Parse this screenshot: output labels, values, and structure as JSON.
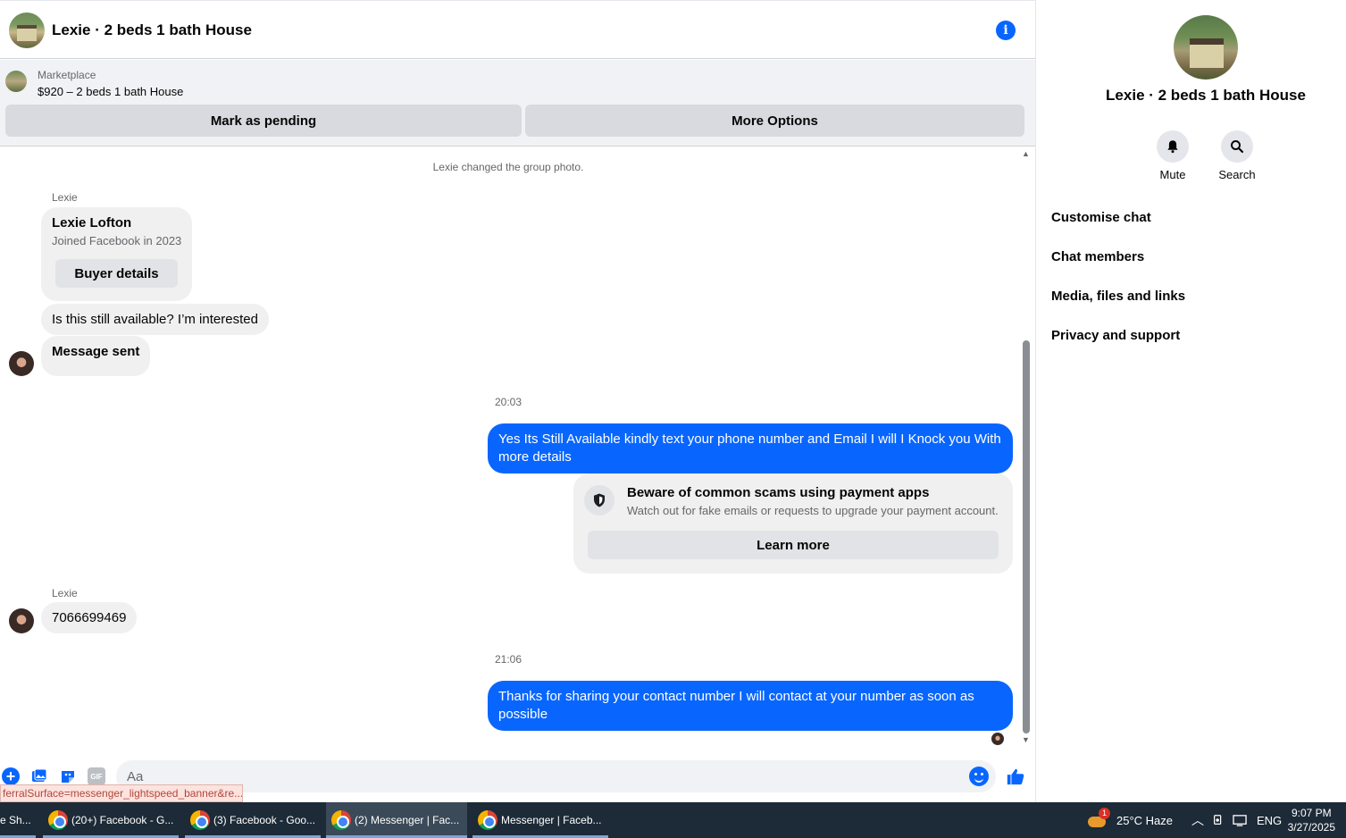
{
  "header": {
    "title": "Lexie · 2 beds 1 bath House"
  },
  "marketplace": {
    "label": "Marketplace",
    "listing": "$920 – 2 beds 1 bath House",
    "pending_btn": "Mark as pending",
    "more_btn": "More Options"
  },
  "messages": {
    "system_top": "Lexie changed the group photo.",
    "sender_1": "Lexie",
    "profile": {
      "name": "Lexie Lofton",
      "joined": "Joined Facebook in 2023",
      "button": "Buyer details"
    },
    "msg_1": "Is this still available? I’m interested",
    "msg_2": "Message sent",
    "time_1": "20:03",
    "out_1": "Yes Its Still Available kindly text your phone number and Email I will I Knock you With more details",
    "scam": {
      "title": "Beware of common scams using payment apps",
      "desc": "Watch out for fake emails or requests to upgrade your payment account.",
      "button": "Learn more"
    },
    "sender_2": "Lexie",
    "msg_3": "7066699469",
    "time_2": "21:06",
    "out_2": "Thanks for sharing your contact number I will contact at your number as soon as possible"
  },
  "composer": {
    "placeholder": "Aa",
    "gif": "GIF"
  },
  "status_url": "ferralSurface=messenger_lightspeed_banner&re...",
  "panel": {
    "title": "Lexie · 2 beds 1 bath House",
    "mute": "Mute",
    "search": "Search",
    "menu": [
      "Customise chat",
      "Chat members",
      "Media, files and links",
      "Privacy and support"
    ]
  },
  "taskbar": {
    "items": [
      "e Sh...",
      "(20+) Facebook - G...",
      "(3) Facebook - Goo...",
      "(2) Messenger | Fac...",
      "Messenger | Faceb..."
    ],
    "weather": "25°C  Haze",
    "weather_badge": "1",
    "lang": "ENG",
    "time": "9:07 PM",
    "date": "3/27/2025"
  },
  "colors": {
    "accent": "#0866ff",
    "taskbar": "#1d2a37"
  }
}
